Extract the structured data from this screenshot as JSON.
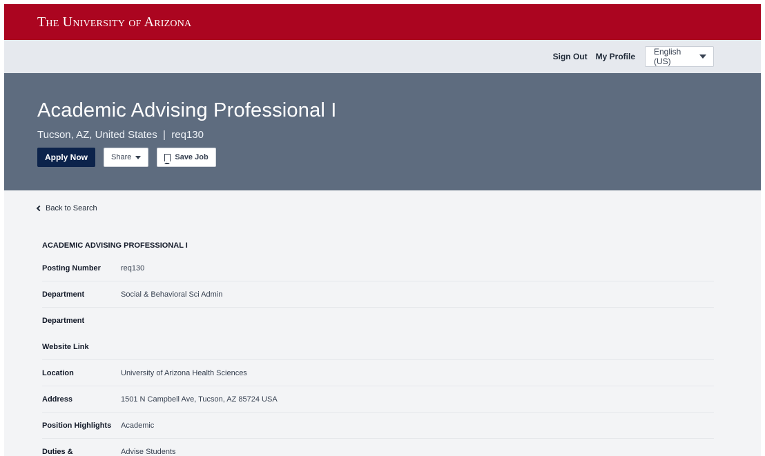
{
  "brand": {
    "title": "The University of Arizona"
  },
  "utility_nav": {
    "sign_out": "Sign Out",
    "my_profile": "My Profile",
    "language": "English (US)"
  },
  "hero": {
    "title": "Academic Advising Professional I",
    "subtitle": "Tucson, AZ, United States  |  req130",
    "apply_label": "Apply Now",
    "share_label": "Share",
    "save_label": "Save Job"
  },
  "back_label": "Back to Search",
  "details": {
    "heading": "ACADEMIC ADVISING PROFESSIONAL I",
    "rows": [
      {
        "label": "Posting Number",
        "value": "req130"
      },
      {
        "label": "Department",
        "value": "Social & Behavioral Sci Admin"
      },
      {
        "label": "Department",
        "value": ""
      },
      {
        "label": "Website Link",
        "value": ""
      },
      {
        "label": "Location",
        "value": "University of Arizona Health Sciences"
      },
      {
        "label": "Address",
        "value": "1501 N Campbell Ave, Tucson, AZ 85724 USA"
      },
      {
        "label": "Position Highlights",
        "value": "Academic"
      },
      {
        "label": "Duties &",
        "value": "Advise Students"
      }
    ]
  },
  "colors": {
    "brand_red": "#ab0520",
    "hero_slate": "#5e6c7f",
    "apply_navy": "#0c234b"
  }
}
